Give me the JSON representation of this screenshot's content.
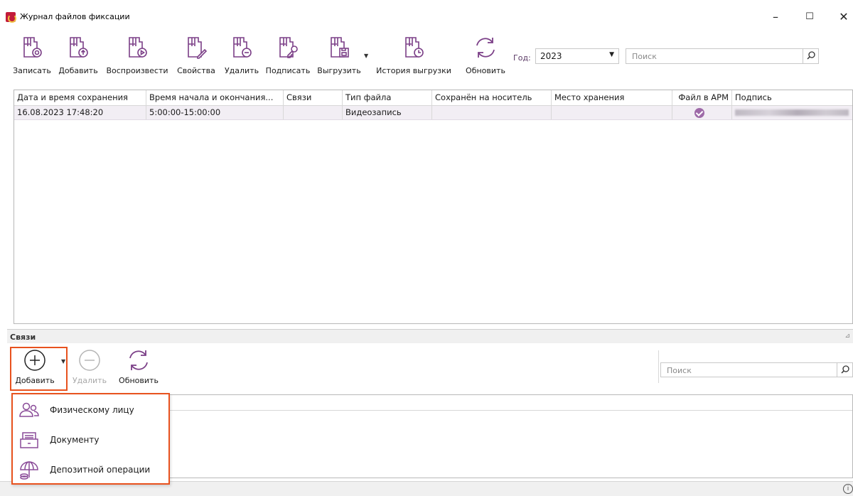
{
  "window": {
    "title": "Журнал файлов фиксации",
    "minimize": "–",
    "maximize": "☐",
    "close": "✕"
  },
  "toolbar": {
    "record": "Записать",
    "add": "Добавить",
    "play": "Воспроизвести",
    "properties": "Свойства",
    "delete": "Удалить",
    "sign": "Подписать",
    "export": "Выгрузить",
    "export_history": "История выгрузки",
    "refresh": "Обновить",
    "year_label": "Год:",
    "year_value": "2023",
    "search_placeholder": "Поиск"
  },
  "grid": {
    "columns": [
      "Дата и время сохранения",
      "Время начала и окончания...",
      "Связи",
      "Тип файла",
      "Сохранён на носитель",
      "Место хранения",
      "Файл в АРМ",
      "Подпись"
    ],
    "rows": [
      {
        "saved_at": "16.08.2023 17:48:20",
        "time_range": "5:00:00-15:00:00",
        "links": "",
        "file_type": "Видеозапись",
        "saved_to_media": "",
        "storage": "",
        "in_arm": true,
        "signature": ""
      }
    ]
  },
  "links_panel": {
    "title": "Связи",
    "add": "Добавить",
    "delete": "Удалить",
    "refresh": "Обновить",
    "search_placeholder": "Поиск"
  },
  "add_menu": {
    "items": [
      {
        "label": "Физическому лицу",
        "icon": "people-icon"
      },
      {
        "label": "Документу",
        "icon": "document-tray-icon"
      },
      {
        "label": "Депозитной операции",
        "icon": "umbrella-coins-icon"
      }
    ]
  },
  "colors": {
    "accent": "#8a4b98",
    "highlight": "#e8521e",
    "row_selected": "#f2eef4"
  }
}
